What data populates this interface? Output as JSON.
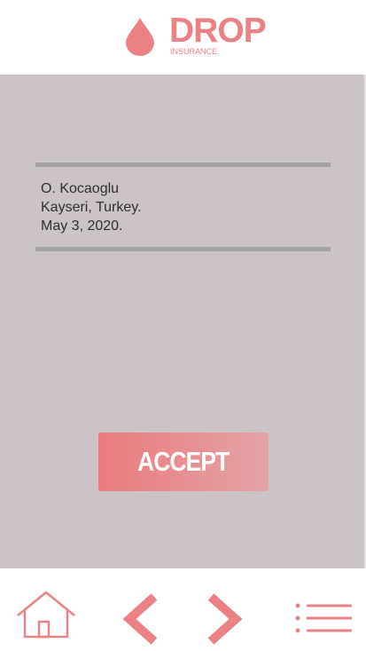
{
  "app": {
    "logo_word": "DROP",
    "logo_sub": "INSURANCE",
    "brand_color": "#ec8185"
  },
  "document": {
    "name": "O. Kocaoglu",
    "location": "Kayseri, Turkey.",
    "date": "May 3, 2020."
  },
  "actions": {
    "accept_label": "ACCEPT"
  },
  "navbar": {
    "items": [
      {
        "icon": "home-icon"
      },
      {
        "icon": "chevron-left-icon"
      },
      {
        "icon": "chevron-right-icon"
      },
      {
        "icon": "menu-icon"
      }
    ]
  },
  "colors": {
    "background": "#cbc3c5",
    "rule": "#a2a3a2",
    "accent": "#ea7b7e"
  }
}
